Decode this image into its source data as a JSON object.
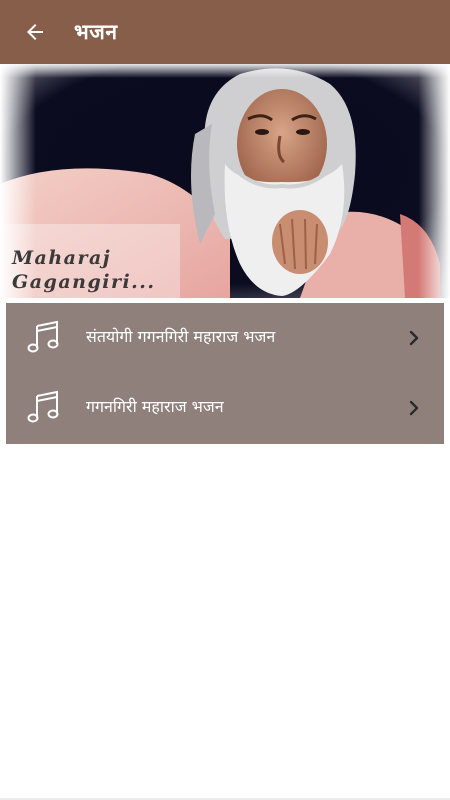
{
  "toolbar": {
    "title": "भजन",
    "back_icon": "arrow-left-icon",
    "background_color": "#865e49"
  },
  "banner": {
    "caption_line1": "Maharaj",
    "caption_line2": "Gagangiri..."
  },
  "list": {
    "background_color": "#8f807c",
    "items": [
      {
        "label": "संतयोगी गगनगिरी महाराज भजन",
        "icon": "music-note-icon",
        "trailing_icon": "chevron-right-icon"
      },
      {
        "label": "गगनगिरी महाराज भजन",
        "icon": "music-note-icon",
        "trailing_icon": "chevron-right-icon"
      }
    ]
  }
}
